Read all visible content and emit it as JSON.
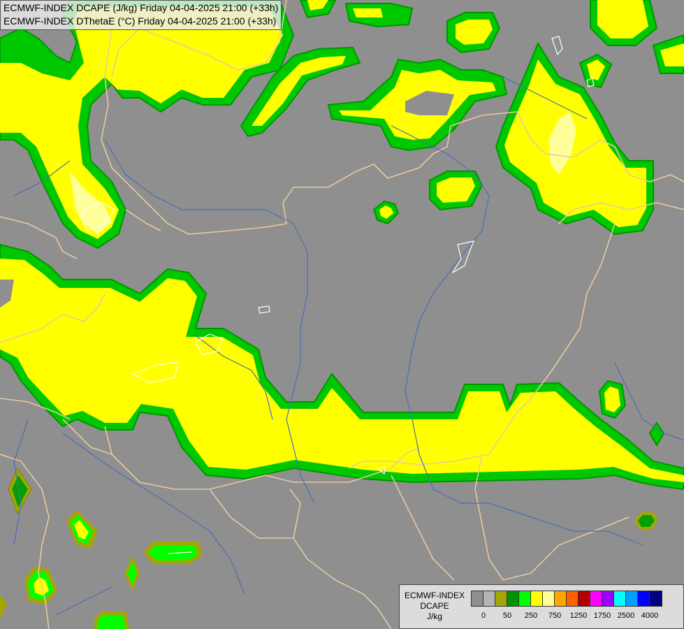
{
  "header": {
    "line1": "ECMWF-INDEX DCAPE (J/kg) Friday 04-04-2025 21:00 (+33h)",
    "line2": "ECMWF-INDEX DThetaE (°C) Friday 04-04-2025 21:00 (+33h)"
  },
  "legend": {
    "title_line1": "ECMWF-INDEX",
    "title_line2": "DCAPE",
    "title_line3": "J/kg",
    "colors": [
      "#8f8f8f",
      "#b5b5b5",
      "#a6a600",
      "#009400",
      "#00ff00",
      "#ffff00",
      "#ffff99",
      "#ffa500",
      "#ff6000",
      "#b40000",
      "#ff00ff",
      "#a000ff",
      "#00ffff",
      "#00a0ff",
      "#0000ff",
      "#000080"
    ],
    "tick_labels": [
      "0",
      "50",
      "250",
      "750",
      "1250",
      "1750",
      "2500",
      "4000"
    ]
  },
  "colors": {
    "background": "#8f8f8f",
    "border_lines": "#e8c9a0",
    "rivers": "#4a6fb5",
    "lakes": "#ffffff"
  }
}
